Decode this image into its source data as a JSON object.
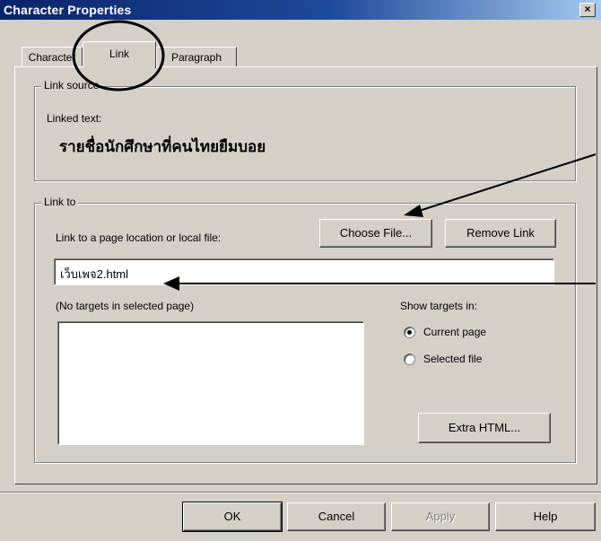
{
  "window": {
    "title": "Character Properties",
    "close_glyph": "×"
  },
  "tabs": [
    {
      "label": "Character",
      "active": false
    },
    {
      "label": "Link",
      "active": true
    },
    {
      "label": "Paragraph",
      "active": false
    }
  ],
  "link_source": {
    "legend": "Link source",
    "linked_text_label": "Linked text:",
    "linked_text_value": "รายชื่อนักศึกษาที่คนไทยยืมบอย"
  },
  "link_to": {
    "legend": "Link to",
    "field_label": "Link to a page location or local file:",
    "field_value": "เว็บเพจ2.html",
    "choose_file_label": "Choose File...",
    "remove_link_label": "Remove Link",
    "targets_label": "(No targets in selected page)",
    "show_targets_label": "Show targets in:",
    "radio_current_label": "Current page",
    "radio_selected_label": "Selected file",
    "radio_current_checked": true,
    "extra_html_label": "Extra HTML..."
  },
  "footer": {
    "ok_label": "OK",
    "cancel_label": "Cancel",
    "apply_label": "Apply",
    "help_label": "Help"
  },
  "annotations": {
    "circle_color": "#000000",
    "arrow_color": "#000000"
  }
}
